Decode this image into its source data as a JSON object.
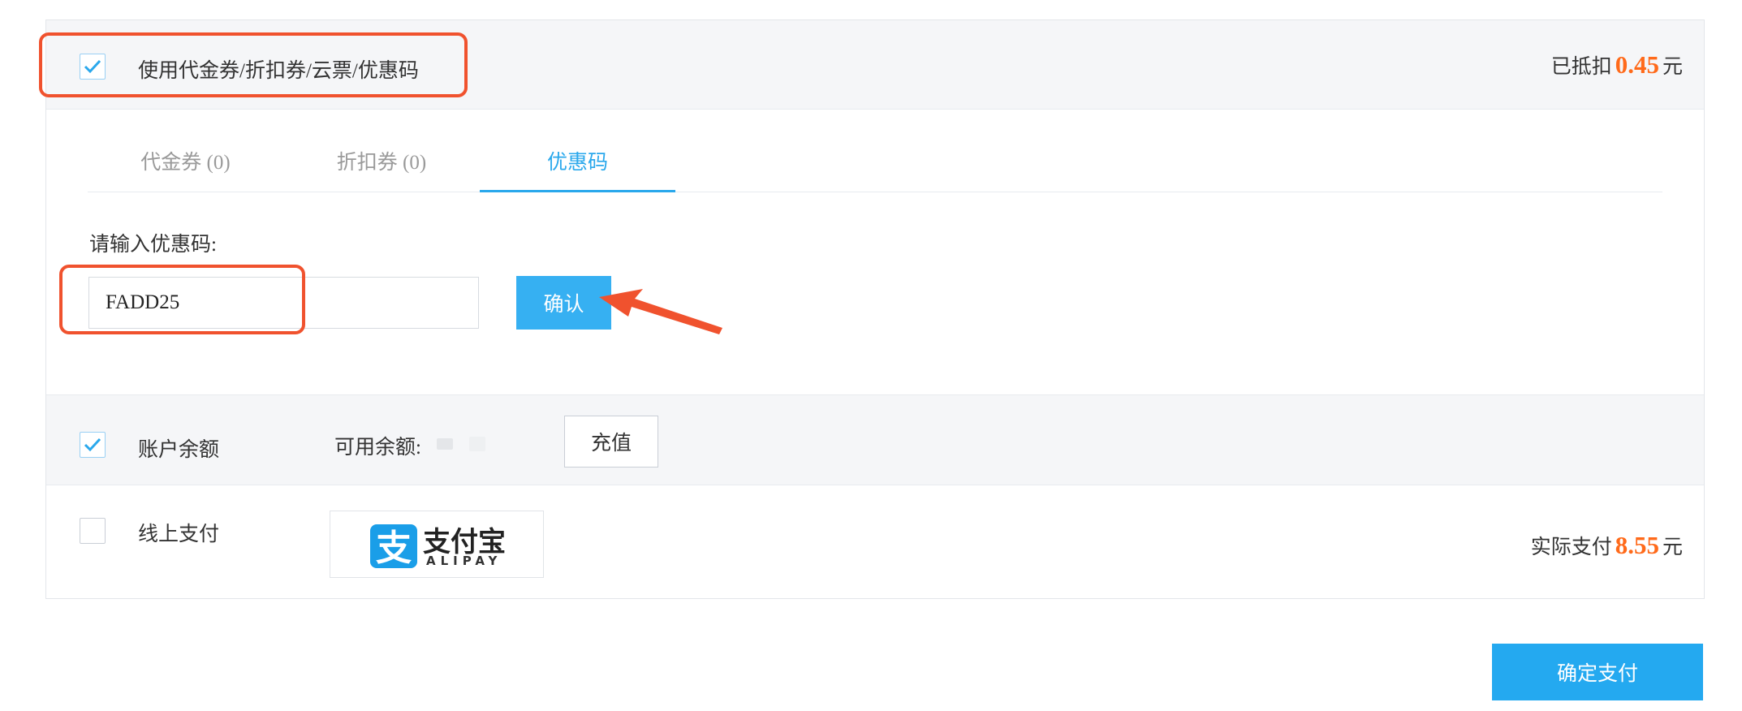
{
  "coupon": {
    "checkbox_checked": true,
    "label": "使用代金券/折扣券/云票/优惠码",
    "deducted_prefix": "已抵扣",
    "deducted_amount": "0.45",
    "deducted_suffix": "元",
    "tabs": [
      {
        "label": "代金券 (0)",
        "active": false
      },
      {
        "label": "折扣券 (0)",
        "active": false
      },
      {
        "label": "优惠码",
        "active": true
      }
    ],
    "prompt": "请输入优惠码:",
    "input_value": "FADD25",
    "confirm_label": "确认"
  },
  "balance": {
    "checkbox_checked": true,
    "label": "账户余额",
    "available_label": "可用余额:",
    "recharge_label": "充值"
  },
  "online": {
    "checkbox_checked": false,
    "label": "线上支付",
    "alipay_name": "支付宝",
    "alipay_sub": "ALIPAY",
    "actual_prefix": "实际支付",
    "actual_amount": "8.55",
    "actual_suffix": "元"
  },
  "pay_button_label": "确定支付",
  "colors": {
    "accent": "#24a9f0",
    "amount": "#ff6a1a",
    "annotation": "#f0522e",
    "section_bg": "#f5f6f8"
  }
}
